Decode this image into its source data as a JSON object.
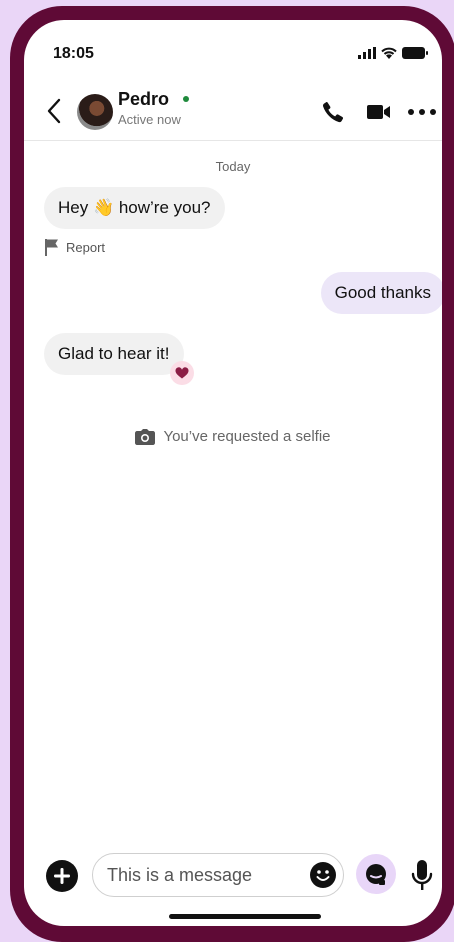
{
  "status_bar": {
    "time": "18:05"
  },
  "header": {
    "contact_name": "Pedro",
    "contact_status": "Active now"
  },
  "conversation": {
    "day_label": "Today",
    "messages": [
      {
        "direction": "incoming",
        "text": "Hey 👋 how’re you?"
      },
      {
        "direction": "outgoing",
        "text": "Good thanks"
      },
      {
        "direction": "incoming",
        "text": "Glad to hear it!",
        "reaction": "heart"
      }
    ],
    "report_label": "Report",
    "selfie_notice": "You’ve requested a selfie"
  },
  "composer": {
    "placeholder": "This is a message"
  },
  "icons": {
    "back": "chevron-left-icon",
    "call": "phone-icon",
    "video": "video-camera-icon",
    "more": "more-horizontal-icon",
    "report": "flag-icon",
    "reaction": "heart-icon",
    "notice": "camera-icon",
    "add": "plus-icon",
    "emoji": "smiley-icon",
    "selfie": "selfie-icon",
    "mic": "microphone-icon"
  },
  "colors": {
    "frame": "#5f0a36",
    "background": "#ead6f7",
    "incoming_bubble": "#f1f1f1",
    "outgoing_bubble": "#ece6f8",
    "online": "#1f8a3c",
    "heart": "#8b1d45"
  }
}
